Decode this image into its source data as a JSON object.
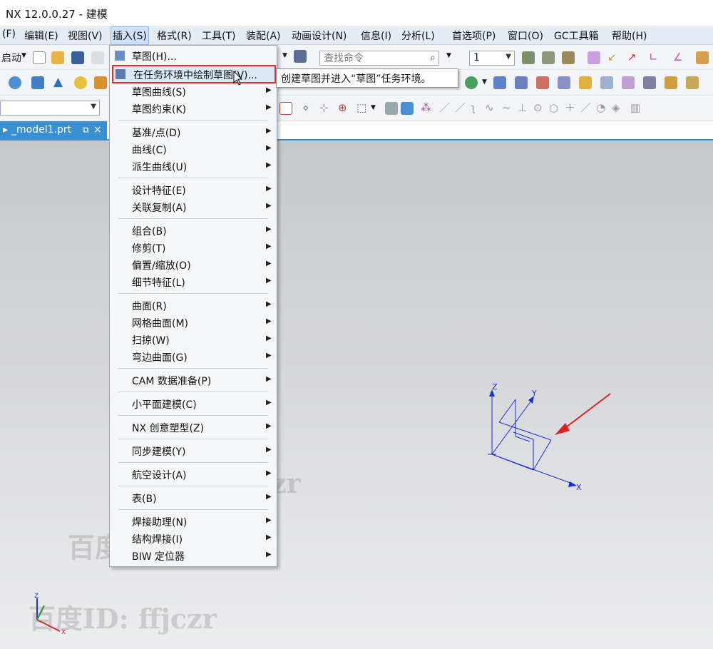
{
  "window": {
    "title": "NX 12.0.0.27 - 建模"
  },
  "menubar": {
    "items": [
      "(F)",
      "编辑(E)",
      "视图(V)",
      "插入(S)",
      "格式(R)",
      "工具(T)",
      "装配(A)",
      "动画设计(N)",
      "信息(I)",
      "分析(L)",
      "首选项(P)",
      "窗口(O)",
      "GC工具箱",
      "帮助(H)"
    ],
    "active": "插入(S)"
  },
  "toolbar": {
    "start_label": "启动",
    "search_placeholder": "查找命令",
    "layer_value": "1"
  },
  "file_tab": {
    "name": "_model1.prt",
    "close_glyph": "×"
  },
  "insert_menu": {
    "items": [
      {
        "label": "草图(H)...",
        "submenu": false,
        "icon": "sketch-icon"
      },
      {
        "label": "在任务环境中绘制草图(V)...",
        "submenu": false,
        "icon": "sketch-task-icon",
        "highlighted": true
      },
      {
        "label": "草图曲线(S)",
        "submenu": true
      },
      {
        "label": "草图约束(K)",
        "submenu": true
      },
      {
        "label": "基准/点(D)",
        "submenu": true
      },
      {
        "label": "曲线(C)",
        "submenu": true
      },
      {
        "label": "派生曲线(U)",
        "submenu": true
      },
      {
        "label": "设计特征(E)",
        "submenu": true
      },
      {
        "label": "关联复制(A)",
        "submenu": true
      },
      {
        "label": "组合(B)",
        "submenu": true
      },
      {
        "label": "修剪(T)",
        "submenu": true
      },
      {
        "label": "偏置/缩放(O)",
        "submenu": true
      },
      {
        "label": "细节特征(L)",
        "submenu": true
      },
      {
        "label": "曲面(R)",
        "submenu": true
      },
      {
        "label": "网格曲面(M)",
        "submenu": true
      },
      {
        "label": "扫掠(W)",
        "submenu": true
      },
      {
        "label": "弯边曲面(G)",
        "submenu": true
      },
      {
        "label": "CAM 数据准备(P)",
        "submenu": true
      },
      {
        "label": "小平面建模(C)",
        "submenu": true
      },
      {
        "label": "NX 创意塑型(Z)",
        "submenu": true
      },
      {
        "label": "同步建模(Y)",
        "submenu": true
      },
      {
        "label": "航空设计(A)",
        "submenu": true
      },
      {
        "label": "表(B)",
        "submenu": true
      },
      {
        "label": "焊接助理(N)",
        "submenu": true
      },
      {
        "label": "结构焊接(I)",
        "submenu": true
      },
      {
        "label": "BIW 定位器",
        "submenu": true
      }
    ]
  },
  "tooltip": {
    "text": "创建草图并进入“草图”任务环境。"
  },
  "viewport": {
    "axis_labels": {
      "x": "X",
      "y": "Y",
      "z": "Z"
    },
    "watermark": "百度ID: ffjczr"
  },
  "colors": {
    "accent": "#3a8fd0",
    "menubar": "#e6ecf3",
    "highlight_border": "#e03030",
    "axis": "#1a2fd0"
  }
}
